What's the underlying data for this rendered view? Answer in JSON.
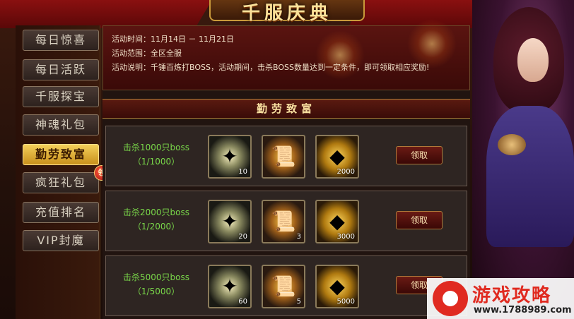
{
  "title": "千服庆典",
  "close_glyph": "✕",
  "sidebar": {
    "items": [
      {
        "label": "每日惊喜"
      },
      {
        "label": "每日活跃"
      },
      {
        "label": "千服探宝"
      },
      {
        "label": "神魂礼包"
      },
      {
        "label": "勤劳致富"
      },
      {
        "label": "疯狂礼包"
      },
      {
        "label": "充值排名"
      },
      {
        "label": "VIP封魔"
      }
    ],
    "active_index": 4,
    "badge_label": "领"
  },
  "info": {
    "time": "活动时间：11月14日 － 11月21日",
    "scope": "活动范围：全区全服",
    "desc": "活动说明：千锤百炼打BOSS，活动期间，击杀BOSS数量达到一定条件，即可领取相应奖励!"
  },
  "section_title": "勤劳致富",
  "rewards": [
    {
      "goal": "击杀1000只boss",
      "progress": "（1/1000）",
      "items": [
        {
          "icon": "card-bundle-icon",
          "count": "10"
        },
        {
          "icon": "scroll-icon",
          "count": ""
        },
        {
          "icon": "gold-ingot-icon",
          "count": "2000"
        }
      ],
      "button": "领取"
    },
    {
      "goal": "击杀2000只boss",
      "progress": "（1/2000）",
      "items": [
        {
          "icon": "card-bundle-icon",
          "count": "20"
        },
        {
          "icon": "scroll-icon",
          "count": "3"
        },
        {
          "icon": "gold-ingot-icon",
          "count": "3000"
        }
      ],
      "button": "领取"
    },
    {
      "goal": "击杀5000只boss",
      "progress": "（1/5000）",
      "items": [
        {
          "icon": "card-bundle-icon",
          "count": "60"
        },
        {
          "icon": "scroll-icon",
          "count": "5"
        },
        {
          "icon": "gold-ingot-icon",
          "count": "5000"
        }
      ],
      "button": "领取"
    }
  ],
  "logo": {
    "text": "游戏攻略",
    "url": "www.1788989.com"
  }
}
